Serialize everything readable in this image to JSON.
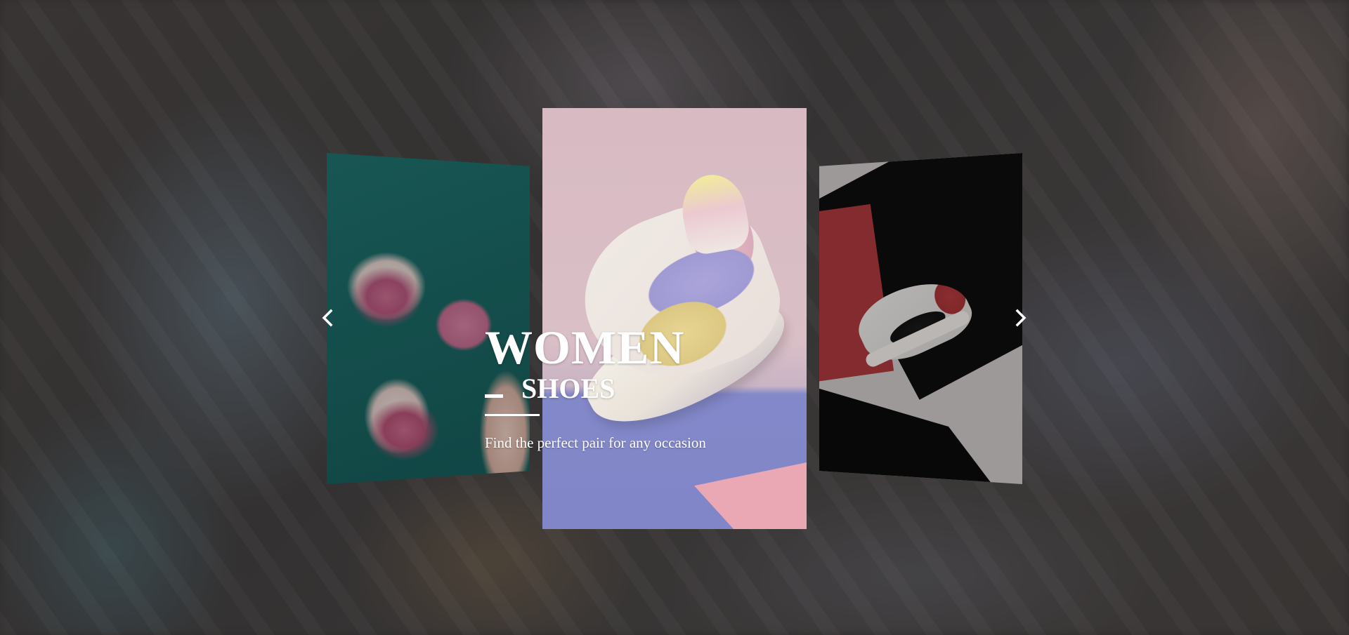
{
  "slider": {
    "caption": {
      "title": "WOMEN",
      "subtitle": "SHOES",
      "text": "Find the perfect pair for any occasion"
    },
    "slides": [
      {
        "name": "baby-knit-shoes-slide"
      },
      {
        "name": "pastel-sneaker-slide"
      },
      {
        "name": "high-top-sneaker-slide"
      }
    ],
    "controls": {
      "prev_icon": "chevron-left-icon",
      "next_icon": "chevron-right-icon"
    }
  },
  "colors": {
    "text": "#ffffff",
    "overlay": "#3a3635"
  }
}
